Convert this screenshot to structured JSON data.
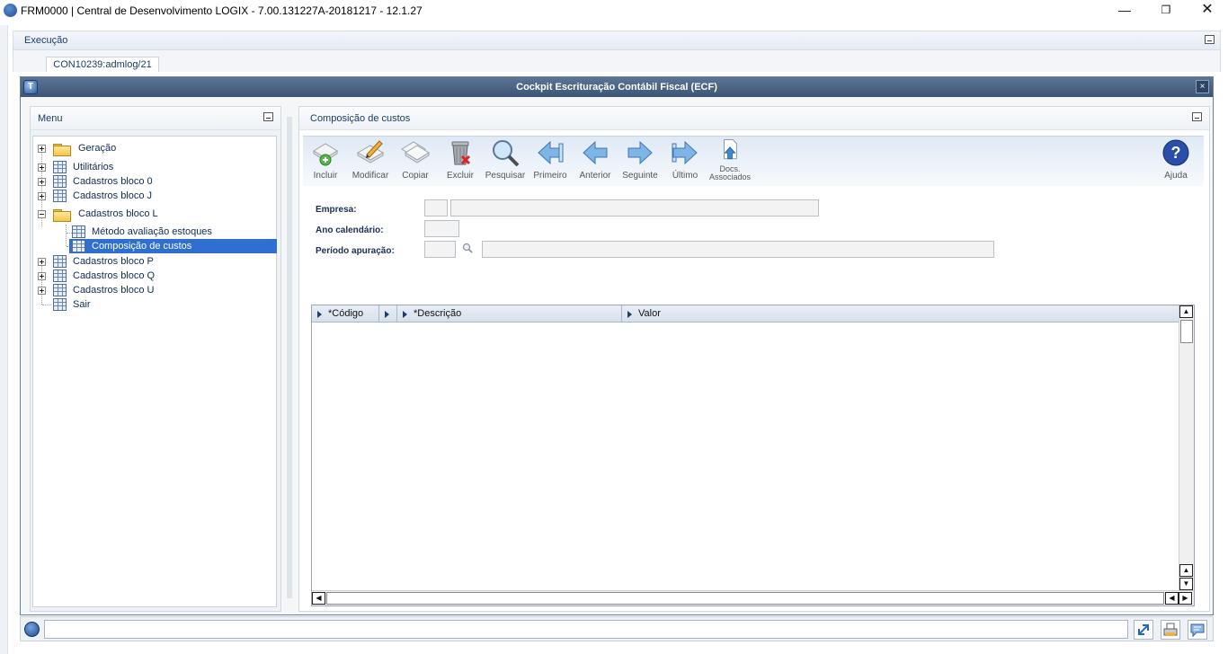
{
  "window": {
    "title": "FRM0000 | Central de Desenvolvimento LOGIX  -  7.00.131227A-20181217  -  12.1.27",
    "minimize": "—",
    "maximize": "❐",
    "close": "✕"
  },
  "execution": {
    "label": "Execução",
    "tab": "CON10239:admlog/21"
  },
  "mainwin": {
    "logo_letter": "T",
    "title": "Cockpit Escrituração Contábil Fiscal (ECF)",
    "close": "×"
  },
  "menu": {
    "title": "Menu",
    "items": [
      {
        "label": "Geração"
      },
      {
        "label": "Utilitários"
      },
      {
        "label": "Cadastros bloco 0"
      },
      {
        "label": "Cadastros bloco J"
      },
      {
        "label": "Cadastros bloco L"
      },
      {
        "label": "Método avaliação estoques"
      },
      {
        "label": "Composição de custos"
      },
      {
        "label": "Cadastros bloco P"
      },
      {
        "label": "Cadastros bloco Q"
      },
      {
        "label": "Cadastros bloco U"
      },
      {
        "label": "Sair"
      }
    ]
  },
  "content": {
    "title": "Composição de custos",
    "toolbar": {
      "incluir": "Incluir",
      "modificar": "Modificar",
      "copiar": "Copiar",
      "excluir": "Excluir",
      "pesquisar": "Pesquisar",
      "primeiro": "Primeiro",
      "anterior": "Anterior",
      "seguinte": "Seguinte",
      "ultimo": "Último",
      "docs_line1": "Docs.",
      "docs_line2": "Associados",
      "ajuda": "Ajuda"
    },
    "form": {
      "empresa_label": "Empresa:",
      "empresa_code": "",
      "empresa_name": "",
      "ano_label": "Ano calendário:",
      "ano_value": "",
      "periodo_label": "Período apuração:",
      "periodo_code": "",
      "periodo_desc": ""
    },
    "grid": {
      "columns": [
        "*Código",
        "*Descrição",
        "Valor"
      ],
      "rows": []
    }
  },
  "colors": {
    "accent": "#2f6fd1",
    "title_bar": "#4a6486",
    "panel_text": "#1b3b66"
  }
}
